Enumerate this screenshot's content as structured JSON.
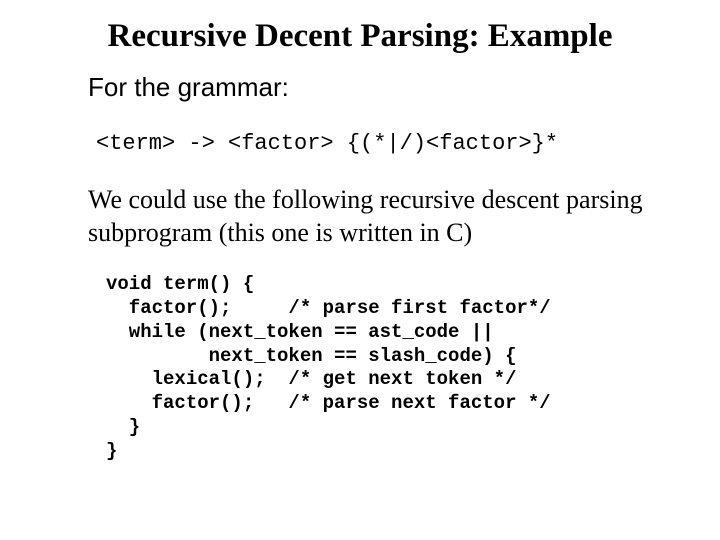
{
  "title": "Recursive Decent Parsing: Example",
  "lead": "For the grammar:",
  "grammar": "<term> -> <factor> {(*|/)<factor>}*",
  "explain": "We could use the following recursive descent parsing subprogram (this one is written in C)",
  "code_lines": [
    "void term() {",
    "  factor();     /* parse first factor*/",
    "  while (next_token == ast_code ||",
    "         next_token == slash_code) {",
    "    lexical();  /* get next token */",
    "    factor();   /* parse next factor */",
    "  }",
    "}"
  ]
}
